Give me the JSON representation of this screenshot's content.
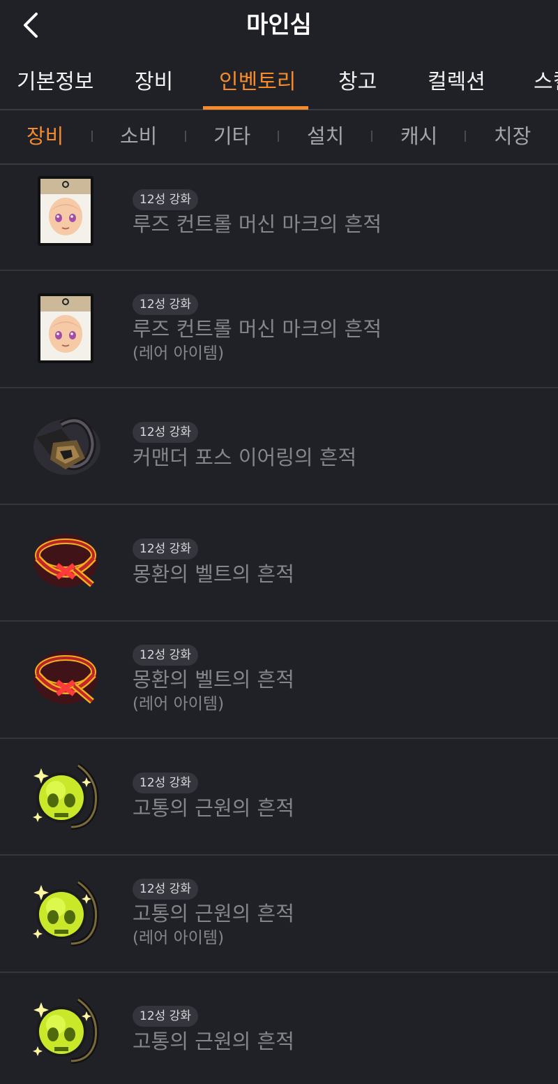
{
  "header": {
    "title": "마인심"
  },
  "tabs": [
    {
      "label": "기본정보"
    },
    {
      "label": "장비"
    },
    {
      "label": "인벤토리"
    },
    {
      "label": "창고"
    },
    {
      "label": "컬렉션"
    },
    {
      "label": "스킬"
    }
  ],
  "subtabs": [
    {
      "label": "장비"
    },
    {
      "label": "소비"
    },
    {
      "label": "기타"
    },
    {
      "label": "설치"
    },
    {
      "label": "캐시"
    },
    {
      "label": "치장"
    }
  ],
  "items": [
    {
      "badge": "12성 강화",
      "name": "루즈 컨트롤 머신 마크의 흔적",
      "sub": "",
      "icon": "mask-face-icon"
    },
    {
      "badge": "12성 강화",
      "name": "루즈 컨트롤 머신 마크의 흔적",
      "sub": "(레어 아이템)",
      "icon": "mask-face-icon"
    },
    {
      "badge": "12성 강화",
      "name": "커맨더 포스 이어링의 흔적",
      "sub": "",
      "icon": "earring-icon"
    },
    {
      "badge": "12성 강화",
      "name": "몽환의 벨트의 흔적",
      "sub": "",
      "icon": "belt-icon"
    },
    {
      "badge": "12성 강화",
      "name": "몽환의 벨트의 흔적",
      "sub": "(레어 아이템)",
      "icon": "belt-icon"
    },
    {
      "badge": "12성 강화",
      "name": "고통의 근원의 흔적",
      "sub": "",
      "icon": "skull-pendant-icon"
    },
    {
      "badge": "12성 강화",
      "name": "고통의 근원의 흔적",
      "sub": "(레어 아이템)",
      "icon": "skull-pendant-icon"
    },
    {
      "badge": "12성 강화",
      "name": "고통의 근원의 흔적",
      "sub": "",
      "icon": "skull-pendant-icon"
    }
  ]
}
